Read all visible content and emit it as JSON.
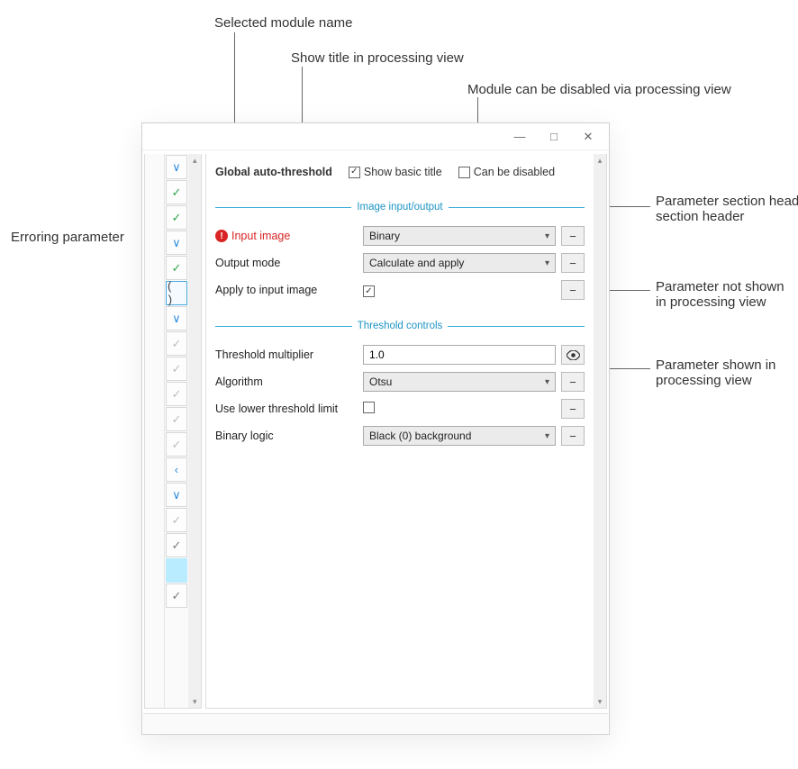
{
  "annotations": {
    "module_name": "Selected module name",
    "show_title": "Show title in processing view",
    "can_disable": "Module can be disabled via processing view",
    "erroring_param": "Erroring parameter",
    "section_header": "Parameter section header",
    "not_shown": "Parameter not shown in processing view",
    "shown": "Parameter shown in processing view"
  },
  "module": {
    "name": "Global auto-threshold",
    "show_title_label": "Show basic title",
    "show_title_checked": true,
    "can_disable_label": "Can be disabled",
    "can_disable_checked": false
  },
  "sections": [
    {
      "title": "Image input/output",
      "params": [
        {
          "label": "Input image",
          "error": true,
          "type": "select",
          "value": "Binary",
          "vis": "hidden"
        },
        {
          "label": "Output mode",
          "type": "select",
          "value": "Calculate and apply",
          "vis": "hidden"
        },
        {
          "label": "Apply to input image",
          "type": "checkbox",
          "checked": true,
          "vis": "hidden"
        }
      ]
    },
    {
      "title": "Threshold controls",
      "params": [
        {
          "label": "Threshold multiplier",
          "type": "text",
          "value": "1.0",
          "vis": "shown"
        },
        {
          "label": "Algorithm",
          "type": "select",
          "value": "Otsu",
          "vis": "hidden"
        },
        {
          "label": "Use lower threshold limit",
          "type": "checkbox",
          "checked": false,
          "vis": "hidden"
        },
        {
          "label": "Binary logic",
          "type": "select",
          "value": "Black (0) background",
          "vis": "hidden"
        }
      ]
    }
  ],
  "icons": {
    "eye_hidden": "−",
    "eye_shown": "◉"
  }
}
